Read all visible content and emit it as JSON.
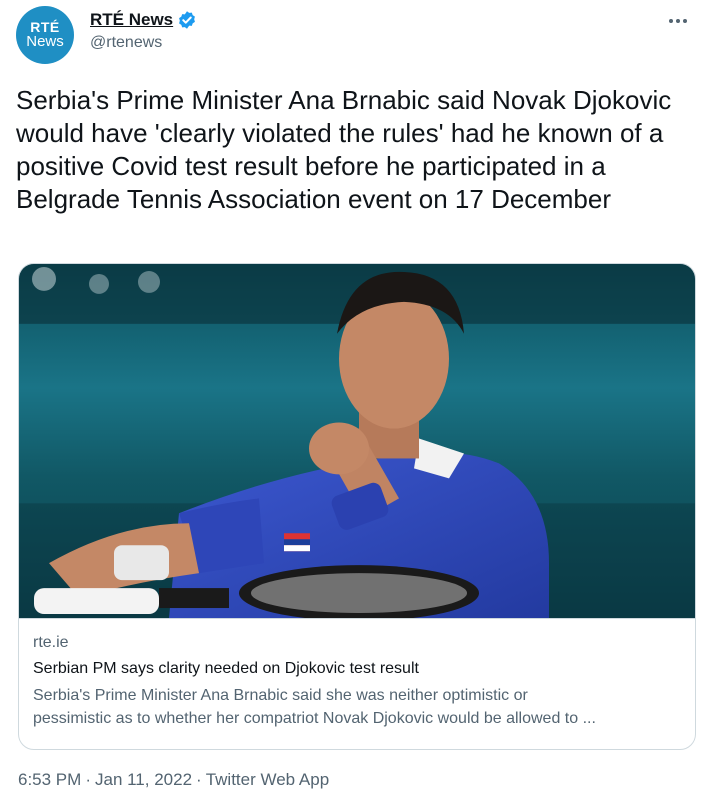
{
  "author": {
    "avatar_line1": "RTÉ",
    "avatar_line2": "News",
    "display_name": "RTÉ News",
    "handle": "@rtenews",
    "verified": true
  },
  "tweet": {
    "text": "Serbia's Prime Minister Ana Brnabic said Novak Djokovic would have 'clearly violated the rules' had he known of a positive Covid test result before he participated in a Belgrade Tennis Association event on 17 December"
  },
  "card": {
    "image_description_icon": "tennis-player-photo",
    "domain": "rte.ie",
    "title": "Serbian PM says clarity needed on Djokovic test result",
    "description_line1": "Serbia's Prime Minister Ana Brnabic said she was neither optimistic or",
    "description_line2": "pessimistic as to whether her compatriot Novak Djokovic would be allowed to ..."
  },
  "footer": {
    "time": "6:53 PM",
    "date": "Jan 11, 2022",
    "source": "Twitter Web App",
    "separator": "·"
  },
  "colors": {
    "accent": "#1d9bf0",
    "secondary_text": "#536471",
    "border": "#cfd9de",
    "avatar_bg": "#1f8fc4"
  },
  "icons": [
    "verified-badge-icon",
    "more-options-icon"
  ]
}
